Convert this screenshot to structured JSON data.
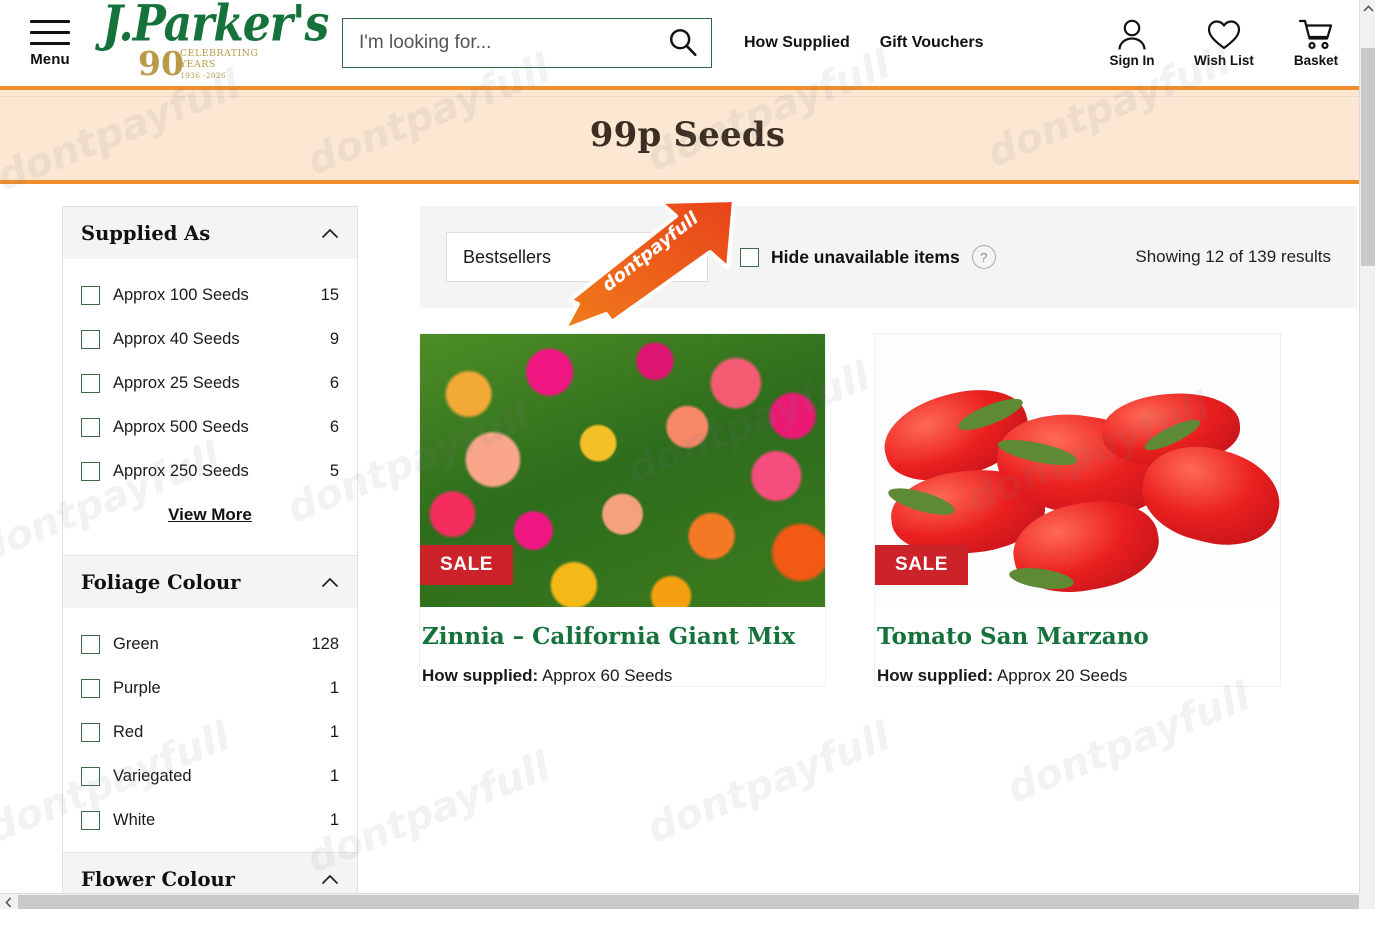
{
  "header": {
    "menu_label": "Menu",
    "logo": {
      "brand": "J.Parker's",
      "anniversary_number": "90",
      "celebrating": "CELEBRATING",
      "years": "YEARS",
      "year_range": "1936 -2026"
    },
    "search": {
      "placeholder": "I'm looking for...",
      "value": "",
      "icon": "search-icon"
    },
    "nav": [
      {
        "label": "How Supplied"
      },
      {
        "label": "Gift Vouchers"
      }
    ],
    "actions": [
      {
        "label": "Sign In",
        "icon": "user-icon"
      },
      {
        "label": "Wish List",
        "icon": "heart-icon"
      },
      {
        "label": "Basket",
        "icon": "cart-icon"
      }
    ]
  },
  "banner": {
    "title": "99p Seeds"
  },
  "sidebar": {
    "facets": [
      {
        "title": "Supplied As",
        "expanded": true,
        "options": [
          {
            "label": "Approx 100 Seeds",
            "count": "15",
            "checked": false
          },
          {
            "label": "Approx 40 Seeds",
            "count": "9",
            "checked": false
          },
          {
            "label": "Approx 25 Seeds",
            "count": "6",
            "checked": false
          },
          {
            "label": "Approx 500 Seeds",
            "count": "6",
            "checked": false
          },
          {
            "label": "Approx 250 Seeds",
            "count": "5",
            "checked": false
          }
        ],
        "view_more": "View More"
      },
      {
        "title": "Foliage Colour",
        "expanded": true,
        "options": [
          {
            "label": "Green",
            "count": "128",
            "checked": false
          },
          {
            "label": "Purple",
            "count": "1",
            "checked": false
          },
          {
            "label": "Red",
            "count": "1",
            "checked": false
          },
          {
            "label": "Variegated",
            "count": "1",
            "checked": false
          },
          {
            "label": "White",
            "count": "1",
            "checked": false
          }
        ]
      },
      {
        "title": "Flower Colour",
        "expanded": true,
        "options": []
      }
    ]
  },
  "toolbar": {
    "sort_value": "Bestsellers",
    "hide_unavailable_label": "Hide unavailable items",
    "hide_unavailable_checked": false,
    "help_icon_label": "?",
    "results_text": "Showing 12 of 139 results"
  },
  "products": [
    {
      "title": "Zinnia – California Giant Mix",
      "badge": "SALE",
      "supplied_label": "How supplied:",
      "supplied_value": "Approx 60 Seeds",
      "image": "zinnia-flowers"
    },
    {
      "title": "Tomato San Marzano",
      "badge": "SALE",
      "supplied_label": "How supplied:",
      "supplied_value": "Approx 20 Seeds",
      "image": "red-plum-tomatoes"
    }
  ],
  "watermark": {
    "text": "dontpayfull",
    "arrow_text": "dontpayfull"
  },
  "colors": {
    "brand_green": "#15723a",
    "accent_orange": "#ef8f2c",
    "banner_bg": "#fce7d2",
    "sale_red": "#cc2229",
    "watermark_orange": "#ef6a15"
  }
}
